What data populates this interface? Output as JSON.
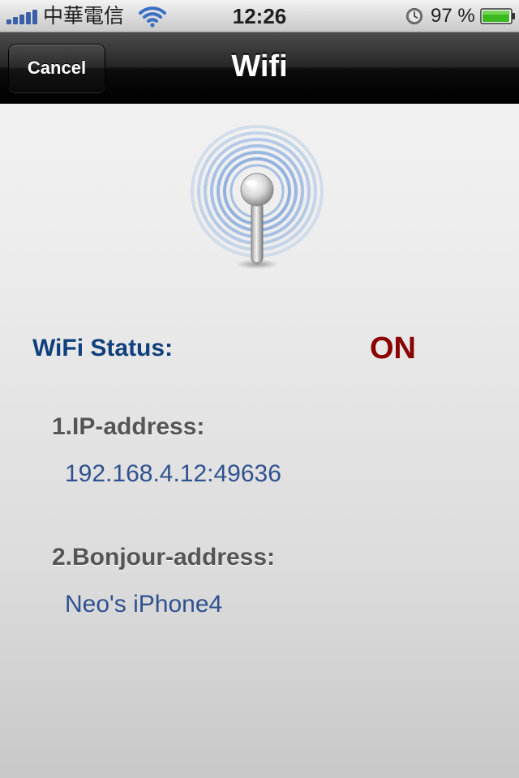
{
  "status_bar": {
    "carrier": "中華電信",
    "time": "12:26",
    "battery": "97 %",
    "battery_level": 0.97,
    "signal_bars": 5,
    "icons": [
      "signal-bars-icon",
      "wifi-icon",
      "alarm-clock-icon",
      "battery-icon"
    ]
  },
  "nav": {
    "title": "Wifi",
    "cancel_label": "Cancel"
  },
  "wifi": {
    "graphic": "antenna-broadcast-icon",
    "status_label": "WiFi Status:",
    "status_value": "ON",
    "ip_heading": "1.IP-address:",
    "ip_value": "192.168.4.12:49636",
    "bonjour_heading": "2.Bonjour-address:",
    "bonjour_value": "Neo's iPhone4"
  },
  "colors": {
    "status_label": "#0f3f7d",
    "status_on": "#8a0000",
    "address_value": "#2f5190",
    "heading": "#555555"
  }
}
